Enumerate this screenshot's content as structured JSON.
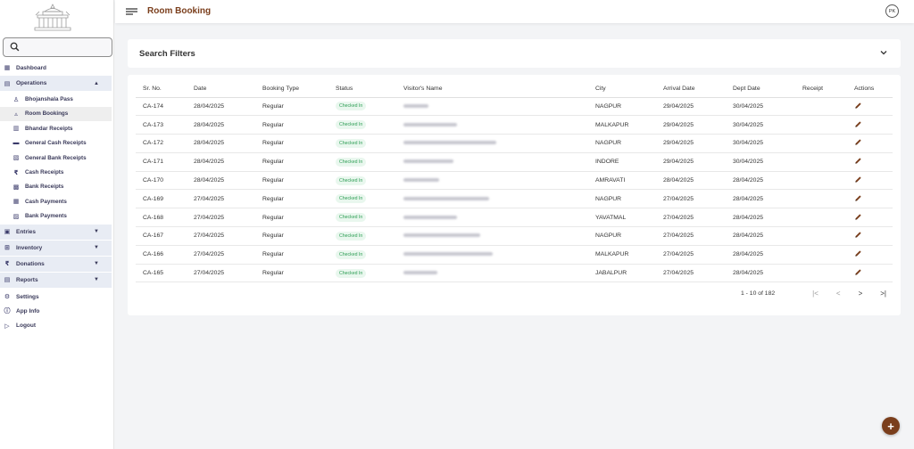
{
  "header": {
    "title": "Room Booking",
    "avatar": "PK"
  },
  "sidebar": {
    "items": [
      {
        "label": "Dashboard",
        "icon": "dashboard-icon",
        "glyph": "▦",
        "type": "top"
      },
      {
        "label": "Operations",
        "icon": "folder-icon",
        "glyph": "▤",
        "type": "group",
        "caret": "▲"
      },
      {
        "label": "Bhojanshala Pass",
        "icon": "person-icon",
        "glyph": "♙",
        "type": "sub"
      },
      {
        "label": "Room Bookings",
        "icon": "bed-icon",
        "glyph": "▵",
        "type": "sub",
        "active": true
      },
      {
        "label": "Bhandar Receipts",
        "icon": "receipt-icon",
        "glyph": "▥",
        "type": "sub"
      },
      {
        "label": "General Cash Receipts",
        "icon": "cash-icon",
        "glyph": "▬",
        "type": "sub"
      },
      {
        "label": "General Bank Receipts",
        "icon": "document-icon",
        "glyph": "▧",
        "type": "sub"
      },
      {
        "label": "Cash Receipts",
        "icon": "rupee-icon",
        "glyph": "₹",
        "type": "sub"
      },
      {
        "label": "Bank Receipts",
        "icon": "bank-icon",
        "glyph": "▩",
        "type": "sub"
      },
      {
        "label": "Cash Payments",
        "icon": "calculator-icon",
        "glyph": "▦",
        "type": "sub"
      },
      {
        "label": "Bank Payments",
        "icon": "card-icon",
        "glyph": "▨",
        "type": "sub"
      },
      {
        "label": "Entries",
        "icon": "entries-icon",
        "glyph": "▣",
        "type": "group",
        "caret": "▼"
      },
      {
        "label": "Inventory",
        "icon": "cart-icon",
        "glyph": "⊞",
        "type": "group",
        "caret": "▼"
      },
      {
        "label": "Donations",
        "icon": "rupee-icon",
        "glyph": "₹",
        "type": "group",
        "caret": "▼"
      },
      {
        "label": "Reports",
        "icon": "reports-icon",
        "glyph": "▤",
        "type": "group",
        "caret": "▼"
      },
      {
        "label": "Settings",
        "icon": "gear-icon",
        "glyph": "⚙",
        "type": "top"
      },
      {
        "label": "App Info",
        "icon": "info-icon",
        "glyph": "ⓘ",
        "type": "top"
      },
      {
        "label": "Logout",
        "icon": "logout-icon",
        "glyph": "▷",
        "type": "top"
      }
    ]
  },
  "filters": {
    "title": "Search Filters"
  },
  "table": {
    "columns": [
      "Sr. No.",
      "Date",
      "Booking Type",
      "Status",
      "Visitor's Name",
      "City",
      "Arrival Date",
      "Dept Date",
      "Receipt",
      "Actions"
    ],
    "rows": [
      {
        "sr": "CA-174",
        "date": "28/04/2025",
        "type": "Regular",
        "status": "Checked In",
        "city": "NAGPUR",
        "arrival": "29/04/2025",
        "dept": "30/04/2025"
      },
      {
        "sr": "CA-173",
        "date": "28/04/2025",
        "type": "Regular",
        "status": "Checked In",
        "city": "MALKAPUR",
        "arrival": "29/04/2025",
        "dept": "30/04/2025"
      },
      {
        "sr": "CA-172",
        "date": "28/04/2025",
        "type": "Regular",
        "status": "Checked In",
        "city": "NAGPUR",
        "arrival": "29/04/2025",
        "dept": "30/04/2025"
      },
      {
        "sr": "CA-171",
        "date": "28/04/2025",
        "type": "Regular",
        "status": "Checked In",
        "city": "INDORE",
        "arrival": "29/04/2025",
        "dept": "30/04/2025"
      },
      {
        "sr": "CA-170",
        "date": "28/04/2025",
        "type": "Regular",
        "status": "Checked In",
        "city": "AMRAVATI",
        "arrival": "28/04/2025",
        "dept": "28/04/2025"
      },
      {
        "sr": "CA-169",
        "date": "27/04/2025",
        "type": "Regular",
        "status": "Checked In",
        "city": "NAGPUR",
        "arrival": "27/04/2025",
        "dept": "28/04/2025"
      },
      {
        "sr": "CA-168",
        "date": "27/04/2025",
        "type": "Regular",
        "status": "Checked In",
        "city": "YAVATMAL",
        "arrival": "27/04/2025",
        "dept": "28/04/2025"
      },
      {
        "sr": "CA-167",
        "date": "27/04/2025",
        "type": "Regular",
        "status": "Checked In",
        "city": "NAGPUR",
        "arrival": "27/04/2025",
        "dept": "28/04/2025"
      },
      {
        "sr": "CA-166",
        "date": "27/04/2025",
        "type": "Regular",
        "status": "Checked In",
        "city": "MALKAPUR",
        "arrival": "27/04/2025",
        "dept": "28/04/2025"
      },
      {
        "sr": "CA-165",
        "date": "27/04/2025",
        "type": "Regular",
        "status": "Checked In",
        "city": "JABALPUR",
        "arrival": "27/04/2025",
        "dept": "28/04/2025"
      }
    ]
  },
  "pagination": {
    "range": "1 - 10 of 182",
    "first": "|<",
    "prev": "<",
    "next": ">",
    "last": ">|"
  },
  "fab": {
    "label": "+"
  },
  "colors": {
    "brand": "#7a3e1c",
    "status_green": "#2e9e55",
    "group_bg": "#e8ecf4"
  }
}
